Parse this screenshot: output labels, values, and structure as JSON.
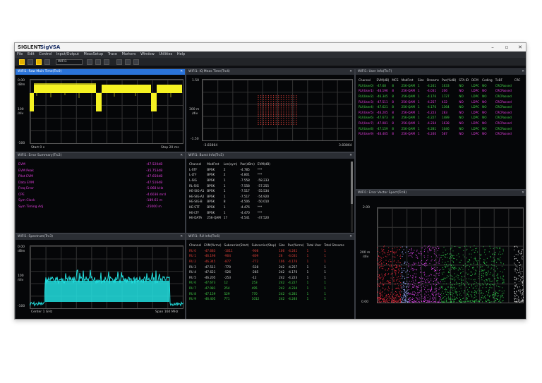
{
  "app": {
    "brand": "SIGLENT",
    "title": "SigVSA"
  },
  "window_controls": {
    "minimize": "–",
    "maximize": "▫",
    "close": "✕"
  },
  "menu": [
    "File",
    "Edit",
    "Control",
    "Input/Output",
    "MeasSetup",
    "Trace",
    "Markers",
    "Window",
    "Utilities",
    "Help"
  ],
  "toolbar": {
    "selector_value": "WIFI1"
  },
  "panels": {
    "raw_main": {
      "title": "WIFI1: Raw Main Time(Trc0)",
      "y_top": "0.00",
      "y_unit": "dBm",
      "y_div": "100",
      "y_div_unit": "/div",
      "y_bottom": "-100",
      "x_left": "Start  0 s",
      "x_right": "Stop  20 ms"
    },
    "iq_meas": {
      "title": "WIFI1: IQ Meas Time(Trc4)",
      "y_top": "1.50",
      "y_div": "300 m",
      "y_div_unit": "/div",
      "y_bottom": "-1.50",
      "x_left": "-3.83864",
      "x_right": "3.83864"
    },
    "user_info": {
      "title": "WIFI1: User Info(Trc7)",
      "headers": [
        "Channel",
        "EVM(dB)",
        "MCS",
        "ModFmt",
        "Size",
        "Streams",
        "Pwr(%dB)",
        "STA-ID",
        "DCM",
        "Coding",
        "TxBF",
        "CRC"
      ],
      "rows": [
        [
          "RU(User0)",
          "-47.68",
          "8",
          "256-QAM",
          "1",
          "-4.241",
          "1633",
          "NO",
          "LDPC",
          "NO",
          "CRCPassed"
        ],
        [
          "RU(User1)",
          "-46.196",
          "8",
          "256-QAM",
          "1",
          "-4.031",
          "206",
          "NO",
          "LDPC",
          "NO",
          "CRCPassed"
        ],
        [
          "RU(User2)",
          "-46.345",
          "8",
          "256-QAM",
          "1",
          "-4.176",
          "1727",
          "NO",
          "LDPC",
          "NO",
          "CRCPassed"
        ],
        [
          "RU(User3)",
          "-47.511",
          "8",
          "256-QAM",
          "1",
          "-4.257",
          "432",
          "NO",
          "LDPC",
          "NO",
          "CRCPassed"
        ],
        [
          "RU(User4)",
          "-47.621",
          "8",
          "256-QAM",
          "1",
          "-4.176",
          "1364",
          "NO",
          "LDPC",
          "NO",
          "CRCPassed"
        ],
        [
          "RU(User5)",
          "-46.205",
          "8",
          "256-QAM",
          "1",
          "-4.223",
          "283",
          "NO",
          "LDPC",
          "NO",
          "CRCPassed"
        ],
        [
          "RU(User6)",
          "-47.673",
          "8",
          "256-QAM",
          "1",
          "-4.227",
          "1489",
          "NO",
          "LDPC",
          "NO",
          "CRCPassed"
        ],
        [
          "RU(User7)",
          "-47.081",
          "8",
          "256-QAM",
          "1",
          "-4.234",
          "1638",
          "NO",
          "LDPC",
          "NO",
          "CRCPassed"
        ],
        [
          "RU(User8)",
          "-47.159",
          "8",
          "256-QAM",
          "1",
          "-4.281",
          "1046",
          "NO",
          "LDPC",
          "NO",
          "CRCPassed"
        ],
        [
          "RU(User9)",
          "-46.405",
          "8",
          "256-QAM",
          "1",
          "-4.240",
          "587",
          "NO",
          "LDPC",
          "NO",
          "CRCPassed"
        ]
      ]
    },
    "error_summary": {
      "title": "WIFI1: Error Summary(Trc2)",
      "items": [
        {
          "label": "EVM",
          "value": "-47.520dB"
        },
        {
          "label": "EVM Peak",
          "value": "-35.753dB"
        },
        {
          "label": "Pilot EVM",
          "value": "-47.650dB"
        },
        {
          "label": "Data EVM",
          "value": "-47.516dB"
        },
        {
          "label": "Freq Error",
          "value": "-5.068 kHz"
        },
        {
          "label": "CPE",
          "value": "-4.6036 mrd"
        },
        {
          "label": "Sym Clock",
          "value": "-189.61 m"
        },
        {
          "label": "Sym Timing Adj",
          "value": "-25000 m"
        }
      ]
    },
    "burst_info": {
      "title": "WIFI1: Burst Info(Trc5)",
      "headers": [
        "Channel",
        "ModFmt",
        "Len(sym)",
        "Pwr(dBm)",
        "EVM(dB)"
      ],
      "rows": [
        [
          "L-STF",
          "BPSK",
          "2",
          "-4.785",
          "***"
        ],
        [
          "L-LTF",
          "BPSK",
          "2",
          "-4.801",
          "***"
        ],
        [
          "L-SIG",
          "BPSK",
          "1",
          "-7.558",
          "-58.233"
        ],
        [
          "RL-SIG",
          "BPSK",
          "1",
          "-7.558",
          "-57.255"
        ],
        [
          "HE-SIG-A1",
          "BPSK",
          "1",
          "-7.517",
          "-55.534"
        ],
        [
          "HE-SIG-A2",
          "BPSK",
          "1",
          "-7.517",
          "-54.920"
        ],
        [
          "HE-SIG-B",
          "BPSK",
          "8",
          "-4.506",
          "-50.010"
        ],
        [
          "HE-STF",
          "BPSK",
          "1",
          "-4.476",
          "***"
        ],
        [
          "HE-LTF",
          "BPSK",
          "1",
          "-4.470",
          "***"
        ],
        [
          "HE-DATA",
          "256-QAM",
          "17",
          "-4.541",
          "-47.520"
        ]
      ]
    },
    "spectrum": {
      "title": "WIFI1: Spectrum(Trc3)",
      "y_top": "0.00",
      "y_unit": "dBm",
      "y_div": "100",
      "y_div_unit": "/div",
      "y_bottom": "-100",
      "x_left": "Center  1 GHz",
      "x_right": "Span  160 MHz"
    },
    "ru_info": {
      "title": "WIFI1: RU Info(Trc6)",
      "headers": [
        "Channel",
        "EVM(%rms)",
        "Subcarrier(Start)",
        "Subcarrier(Stop)",
        "Size",
        "Pwr(%rms)",
        "Total User",
        "Total Streams"
      ],
      "rows": [
        [
          "RU 0",
          "-47.683",
          "-1011",
          "-908",
          "106",
          "-4.241",
          "1",
          "1"
        ],
        [
          "RU 1",
          "-46.196",
          "-904",
          "-809",
          "26",
          "-4.031",
          "1",
          "1"
        ],
        [
          "RU 2",
          "-46.345",
          "-877",
          "-772",
          "106",
          "-4.176",
          "1",
          "1"
        ],
        [
          "RU 3",
          "-47.511",
          "-770",
          "-528",
          "242",
          "-4.257",
          "1",
          "1"
        ],
        [
          "RU 4",
          "-47.621",
          "-526",
          "-285",
          "242",
          "-4.176",
          "1",
          "1"
        ],
        [
          "RU 5",
          "-46.205",
          "-253",
          "-12",
          "242",
          "-4.223",
          "1",
          "1"
        ],
        [
          "RU 6",
          "-47.673",
          "12",
          "253",
          "242",
          "-4.227",
          "1",
          "1"
        ],
        [
          "RU 7",
          "-47.081",
          "254",
          "495",
          "242",
          "-4.234",
          "1",
          "1"
        ],
        [
          "RU 8",
          "-47.159",
          "529",
          "770",
          "242",
          "-4.281",
          "1",
          "1"
        ],
        [
          "RU 9",
          "-46.405",
          "771",
          "1012",
          "242",
          "-4.240",
          "1",
          "1"
        ]
      ]
    },
    "ev_spectrum": {
      "title": "WIFI1: Error Vector Spect(Trc8)",
      "y_top": "2.00",
      "y_div": "200 m",
      "y_div_unit": "/div",
      "y_bottom": "0.00"
    }
  },
  "colors": {
    "yellow_trace": "#f5f222",
    "cyan_trace": "#22e0e0",
    "constellation": "#e8433b",
    "accent": "#2a73d9"
  }
}
